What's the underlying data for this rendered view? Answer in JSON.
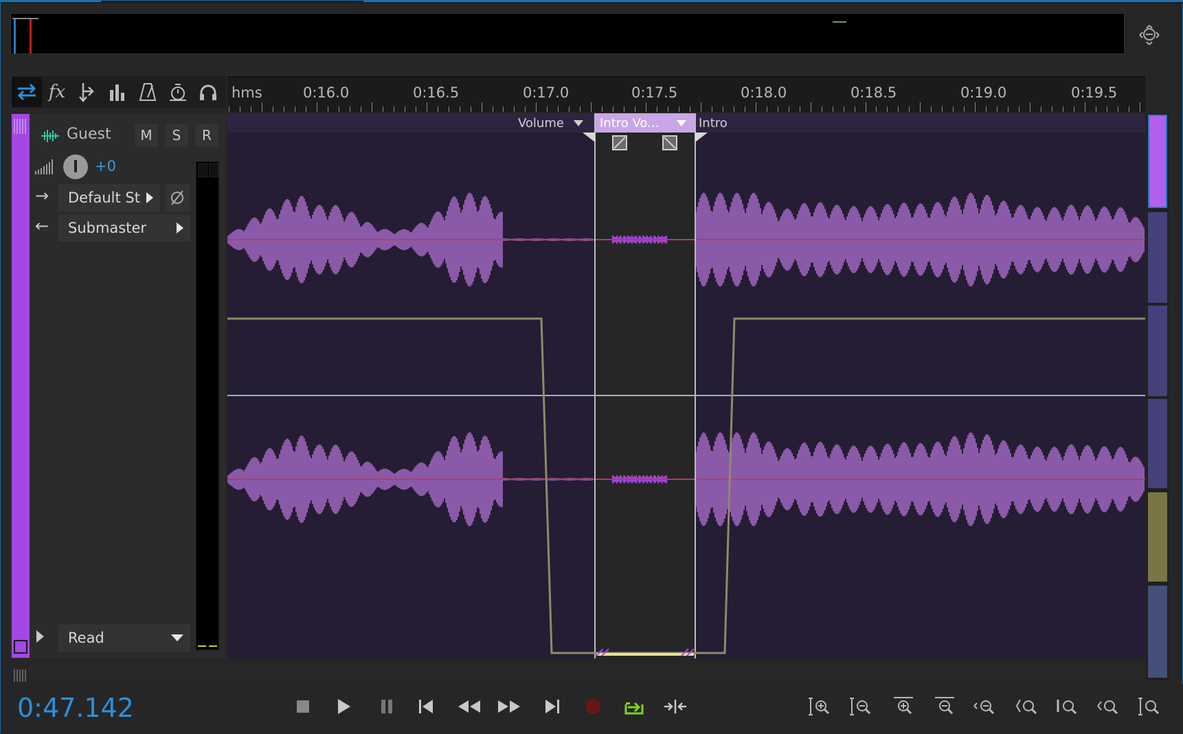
{
  "overview": {
    "label": "overview-timeline"
  },
  "toolbar": {
    "tools": [
      "switch-icon",
      "fx-icon",
      "send-icon",
      "eq-icon",
      "metronome-icon",
      "timer-icon",
      "headphones-icon"
    ]
  },
  "ruler": {
    "unit": "hms",
    "labels": [
      "0:16.0",
      "0:16.5",
      "0:17.0",
      "0:17.5",
      "0:18.0",
      "0:18.5",
      "0:19.0",
      "0:19.5"
    ]
  },
  "track": {
    "name": "Guest",
    "mute": "M",
    "solo": "S",
    "record": "R",
    "volume": "+0",
    "input": "Default St",
    "output": "Submaster",
    "automation_mode": "Read",
    "color": "#a547e6"
  },
  "clips": {
    "left_label": "Volume",
    "selected_label": "Intro Vo...",
    "right_label": "Intro"
  },
  "transport": {
    "timecode": "0:47.142",
    "buttons": [
      "stop-icon",
      "play-icon",
      "pause-icon",
      "go-to-start-icon",
      "rewind-icon",
      "fast-forward-icon",
      "go-to-end-icon",
      "record-icon",
      "loop-icon",
      "skip-selection-icon"
    ]
  },
  "zoom": {
    "buttons": [
      "zoom-in-amplitude-icon",
      "zoom-out-amplitude-icon",
      "zoom-in-time-icon",
      "zoom-out-time-icon",
      "zoom-out-full-icon",
      "zoom-in-left-icon",
      "zoom-in-right-icon",
      "zoom-to-selection-icon",
      "zoom-selected-tracks-icon"
    ]
  },
  "colors": {
    "accent": "#2f8fd8",
    "track": "#a547e6",
    "waveform": "#8a5aa8",
    "envelope": "#8f8a6a",
    "centerline": "#c03448",
    "loop_active": "#7ed321"
  }
}
